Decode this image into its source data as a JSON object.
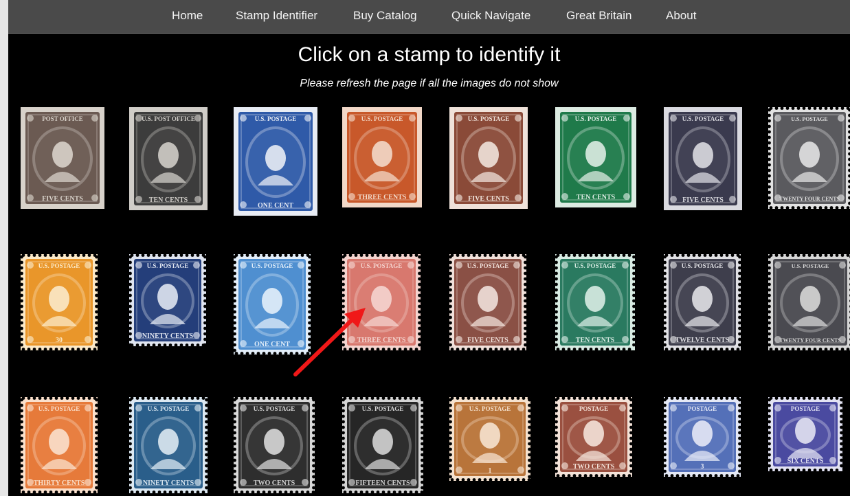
{
  "nav": {
    "items": [
      {
        "label": "Home"
      },
      {
        "label": "Stamp Identifier"
      },
      {
        "label": "Buy Catalog"
      },
      {
        "label": "Quick Navigate"
      },
      {
        "label": "Great Britain"
      },
      {
        "label": "About"
      }
    ]
  },
  "heading": {
    "title": "Click on a stamp to identify it",
    "subtitle": "Please refresh the page if all the images do not show"
  },
  "stamps": [
    {
      "top": "POST OFFICE",
      "bottom": "FIVE CENTS",
      "color": "#6b5a52",
      "paper": "#d8d2ca",
      "style": "imperf"
    },
    {
      "top": "U.S. POST OFFICE",
      "bottom": "TEN CENTS",
      "color": "#3c3c3c",
      "paper": "#d0cdc8",
      "style": "imperf"
    },
    {
      "top": "U.S. POSTAGE",
      "bottom": "ONE CENT",
      "color": "#2f5aa8",
      "paper": "#e8ecf4",
      "style": "imperf"
    },
    {
      "top": "U.S. POSTAGE",
      "bottom": "THREE CENTS",
      "color": "#c8582a",
      "paper": "#f2d8c8",
      "style": "imperf"
    },
    {
      "top": "U.S. POSTAGE",
      "bottom": "FIVE CENTS",
      "color": "#8a4a38",
      "paper": "#efe2da",
      "style": "imperf"
    },
    {
      "top": "U.S. POSTAGE",
      "bottom": "TEN CENTS",
      "color": "#1f7a4a",
      "paper": "#dcebe2",
      "style": "imperf"
    },
    {
      "top": "U.S. POSTAGE",
      "bottom": "FIVE CENTS",
      "color": "#3a3a4e",
      "paper": "#dadae0",
      "style": "imperf"
    },
    {
      "top": "U.S. POSTAGE",
      "bottom": "TWENTY FOUR CENTS",
      "color": "#5a5a5e",
      "paper": "#e2e2e2",
      "style": "perf"
    },
    {
      "top": "U.S. POSTAGE",
      "bottom": "30",
      "color": "#e9962a",
      "paper": "#fbe9c8",
      "style": "perf"
    },
    {
      "top": "U.S. POSTAGE",
      "bottom": "NINETY CENTS",
      "color": "#243e7a",
      "paper": "#dfe4ef",
      "style": "perf"
    },
    {
      "top": "U.S. POSTAGE",
      "bottom": "ONE CENT",
      "color": "#4f8fd0",
      "paper": "#e3eef9",
      "style": "perf"
    },
    {
      "top": "U.S. POSTAGE",
      "bottom": "THREE CENTS",
      "color": "#d8786e",
      "paper": "#f4d4cf",
      "style": "perf"
    },
    {
      "top": "U.S. POSTAGE",
      "bottom": "FIVE CENTS",
      "color": "#8a5045",
      "paper": "#f0e0da",
      "style": "perf"
    },
    {
      "top": "U.S. POSTAGE",
      "bottom": "TEN CENTS",
      "color": "#2a7a60",
      "paper": "#d8ebe3",
      "style": "perf"
    },
    {
      "top": "U.S. POSTAGE",
      "bottom": "TWELVE CENTS",
      "color": "#3e3e4c",
      "paper": "#e0e0e4",
      "style": "perf"
    },
    {
      "top": "U.S. POSTAGE",
      "bottom": "TWENTY FOUR CENTS",
      "color": "#4a4a50",
      "paper": "#d6d6d6",
      "style": "perf"
    },
    {
      "top": "U.S. POSTAGE",
      "bottom": "THIRTY CENTS",
      "color": "#e67a3a",
      "paper": "#fae0cc",
      "style": "perf"
    },
    {
      "top": "U.S. POSTAGE",
      "bottom": "NINETY CENTS",
      "color": "#2a5e8a",
      "paper": "#dce8f1",
      "style": "perf"
    },
    {
      "top": "U.S. POSTAGE",
      "bottom": "TWO CENTS",
      "color": "#2e2e2e",
      "paper": "#d8d8d8",
      "style": "perf"
    },
    {
      "top": "U.S. POSTAGE",
      "bottom": "FIFTEEN CENTS",
      "color": "#262626",
      "paper": "#d4d4d4",
      "style": "perf"
    },
    {
      "top": "U.S. POSTAGE",
      "bottom": "1",
      "color": "#b8743a",
      "paper": "#f5e2cf",
      "style": "perf"
    },
    {
      "top": "POSTAGE",
      "bottom": "TWO CENTS",
      "color": "#9a5040",
      "paper": "#f3e2d8",
      "style": "perf"
    },
    {
      "top": "POSTAGE",
      "bottom": "3",
      "color": "#5470b8",
      "paper": "#e4e8f5",
      "style": "perf"
    },
    {
      "top": "POSTAGE",
      "bottom": "SIX CENTS",
      "color": "#4a4aa0",
      "paper": "#e2e2f2",
      "style": "perf"
    }
  ],
  "annotation": {
    "arrow_color": "#f01818"
  }
}
